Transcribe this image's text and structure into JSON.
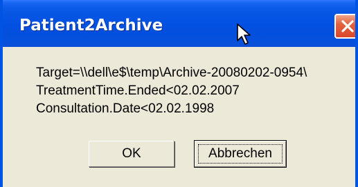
{
  "dialog": {
    "title": "Patient2Archive",
    "message_lines": [
      "Target=\\\\dell\\e$\\temp\\Archive-20080202-0954\\",
      "TreatmentTime.Ended<02.02.2007",
      "Consultation.Date<02.02.1998"
    ],
    "ok_label": "OK",
    "cancel_label": "Abbrechen",
    "close_icon": "close-icon",
    "cursor_icon": "mouse-pointer-icon"
  },
  "colors": {
    "titlebar": "#0250e0",
    "close_button": "#e3633e",
    "client_background": "#ece9d8"
  }
}
